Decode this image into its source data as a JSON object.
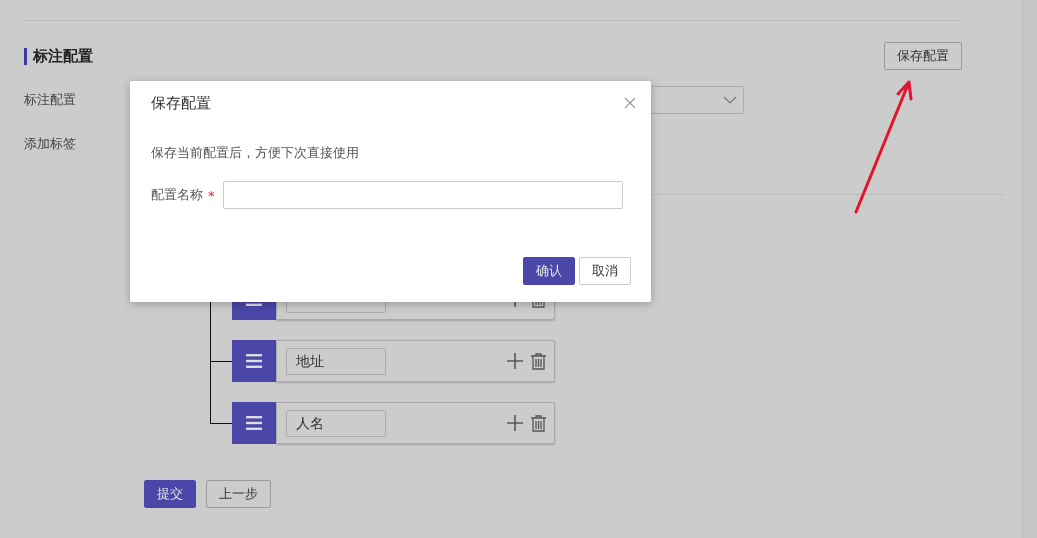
{
  "section": {
    "title": "标注配置",
    "save_button": "保存配置"
  },
  "form": {
    "fields": [
      {
        "label": "标注配置",
        "kind": "select"
      },
      {
        "label": "添加标签",
        "kind": "tags"
      }
    ]
  },
  "tag_row_under_dialog": true,
  "tags": [
    {
      "name": "地址"
    },
    {
      "name": "人名"
    }
  ],
  "actions": {
    "submit": "提交",
    "back": "上一步"
  },
  "dialog": {
    "title": "保存配置",
    "description": "保存当前配置后，方便下次直接使用",
    "field": {
      "label": "配置名称",
      "required_mark": "*"
    },
    "buttons": [
      {
        "label": "确认",
        "kind": "primary"
      },
      {
        "label": "取消",
        "kind": "default"
      }
    ]
  }
}
